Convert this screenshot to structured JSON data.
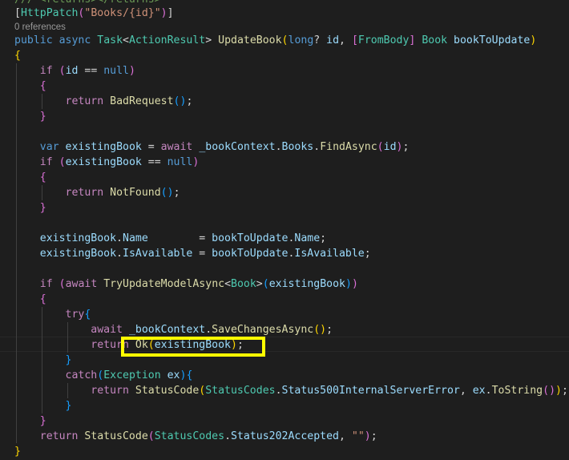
{
  "code": {
    "l0": "/// <returns></returns>",
    "l1": [
      {
        "t": "[",
        "c": "p"
      },
      {
        "t": "HttpPatch",
        "c": "type"
      },
      {
        "t": "(",
        "c": "b2"
      },
      {
        "t": "\"Books/{id}\"",
        "c": "str"
      },
      {
        "t": ")",
        "c": "b2"
      },
      {
        "t": "]",
        "c": "p"
      }
    ],
    "refs": "0 references",
    "l3": [
      {
        "t": "public",
        "c": "kw"
      },
      {
        "t": " ",
        "c": "p"
      },
      {
        "t": "async",
        "c": "kw"
      },
      {
        "t": " ",
        "c": "p"
      },
      {
        "t": "Task",
        "c": "type"
      },
      {
        "t": "<",
        "c": "p"
      },
      {
        "t": "ActionResult",
        "c": "type"
      },
      {
        "t": "> ",
        "c": "p"
      },
      {
        "t": "UpdateBook",
        "c": "fn"
      },
      {
        "t": "(",
        "c": "b1"
      },
      {
        "t": "long",
        "c": "kw"
      },
      {
        "t": "? ",
        "c": "p"
      },
      {
        "t": "id",
        "c": "var"
      },
      {
        "t": ", ",
        "c": "p"
      },
      {
        "t": "[",
        "c": "b2"
      },
      {
        "t": "FromBody",
        "c": "type"
      },
      {
        "t": "]",
        "c": "b2"
      },
      {
        "t": " ",
        "c": "p"
      },
      {
        "t": "Book",
        "c": "type"
      },
      {
        "t": " ",
        "c": "p"
      },
      {
        "t": "bookToUpdate",
        "c": "var"
      },
      {
        "t": ")",
        "c": "b1"
      }
    ],
    "l4": [
      {
        "t": "{",
        "c": "b1"
      }
    ],
    "l5": [
      {
        "t": "    ",
        "c": "p"
      },
      {
        "t": "if",
        "c": "ctl"
      },
      {
        "t": " ",
        "c": "p"
      },
      {
        "t": "(",
        "c": "b2"
      },
      {
        "t": "id",
        "c": "var"
      },
      {
        "t": " == ",
        "c": "p"
      },
      {
        "t": "null",
        "c": "kw"
      },
      {
        "t": ")",
        "c": "b2"
      }
    ],
    "l6": [
      {
        "t": "    ",
        "c": "p"
      },
      {
        "t": "{",
        "c": "b2"
      }
    ],
    "l7": [
      {
        "t": "        ",
        "c": "p"
      },
      {
        "t": "return",
        "c": "ctl"
      },
      {
        "t": " ",
        "c": "p"
      },
      {
        "t": "BadRequest",
        "c": "fn"
      },
      {
        "t": "(",
        "c": "b3"
      },
      {
        "t": ")",
        "c": "b3"
      },
      {
        "t": ";",
        "c": "p"
      }
    ],
    "l8": [
      {
        "t": "    ",
        "c": "p"
      },
      {
        "t": "}",
        "c": "b2"
      }
    ],
    "l10": [
      {
        "t": "    ",
        "c": "p"
      },
      {
        "t": "var",
        "c": "kw"
      },
      {
        "t": " ",
        "c": "p"
      },
      {
        "t": "existingBook",
        "c": "var"
      },
      {
        "t": " = ",
        "c": "p"
      },
      {
        "t": "await",
        "c": "ctl"
      },
      {
        "t": " ",
        "c": "p"
      },
      {
        "t": "_bookContext",
        "c": "var"
      },
      {
        "t": ".",
        "c": "p"
      },
      {
        "t": "Books",
        "c": "var"
      },
      {
        "t": ".",
        "c": "p"
      },
      {
        "t": "FindAsync",
        "c": "fn"
      },
      {
        "t": "(",
        "c": "b2"
      },
      {
        "t": "id",
        "c": "var"
      },
      {
        "t": ")",
        "c": "b2"
      },
      {
        "t": ";",
        "c": "p"
      }
    ],
    "l11": [
      {
        "t": "    ",
        "c": "p"
      },
      {
        "t": "if",
        "c": "ctl"
      },
      {
        "t": " ",
        "c": "p"
      },
      {
        "t": "(",
        "c": "b2"
      },
      {
        "t": "existingBook",
        "c": "var"
      },
      {
        "t": " == ",
        "c": "p"
      },
      {
        "t": "null",
        "c": "kw"
      },
      {
        "t": ")",
        "c": "b2"
      }
    ],
    "l12": [
      {
        "t": "    ",
        "c": "p"
      },
      {
        "t": "{",
        "c": "b2"
      }
    ],
    "l13": [
      {
        "t": "        ",
        "c": "p"
      },
      {
        "t": "return",
        "c": "ctl"
      },
      {
        "t": " ",
        "c": "p"
      },
      {
        "t": "NotFound",
        "c": "fn"
      },
      {
        "t": "(",
        "c": "b3"
      },
      {
        "t": ")",
        "c": "b3"
      },
      {
        "t": ";",
        "c": "p"
      }
    ],
    "l14": [
      {
        "t": "    ",
        "c": "p"
      },
      {
        "t": "}",
        "c": "b2"
      }
    ],
    "l16": [
      {
        "t": "    ",
        "c": "p"
      },
      {
        "t": "existingBook",
        "c": "var"
      },
      {
        "t": ".",
        "c": "p"
      },
      {
        "t": "Name",
        "c": "var"
      },
      {
        "t": "        = ",
        "c": "p"
      },
      {
        "t": "bookToUpdate",
        "c": "var"
      },
      {
        "t": ".",
        "c": "p"
      },
      {
        "t": "Name",
        "c": "var"
      },
      {
        "t": ";",
        "c": "p"
      }
    ],
    "l17": [
      {
        "t": "    ",
        "c": "p"
      },
      {
        "t": "existingBook",
        "c": "var"
      },
      {
        "t": ".",
        "c": "p"
      },
      {
        "t": "IsAvailable",
        "c": "var"
      },
      {
        "t": " = ",
        "c": "p"
      },
      {
        "t": "bookToUpdate",
        "c": "var"
      },
      {
        "t": ".",
        "c": "p"
      },
      {
        "t": "IsAvailable",
        "c": "var"
      },
      {
        "t": ";",
        "c": "p"
      }
    ],
    "l19": [
      {
        "t": "    ",
        "c": "p"
      },
      {
        "t": "if",
        "c": "ctl"
      },
      {
        "t": " ",
        "c": "p"
      },
      {
        "t": "(",
        "c": "b2"
      },
      {
        "t": "await",
        "c": "ctl"
      },
      {
        "t": " ",
        "c": "p"
      },
      {
        "t": "TryUpdateModelAsync",
        "c": "fn"
      },
      {
        "t": "<",
        "c": "p"
      },
      {
        "t": "Book",
        "c": "type"
      },
      {
        "t": ">",
        "c": "p"
      },
      {
        "t": "(",
        "c": "b3"
      },
      {
        "t": "existingBook",
        "c": "var"
      },
      {
        "t": ")",
        "c": "b3"
      },
      {
        "t": ")",
        "c": "b2"
      }
    ],
    "l20": [
      {
        "t": "    ",
        "c": "p"
      },
      {
        "t": "{",
        "c": "b2"
      }
    ],
    "l21": [
      {
        "t": "        ",
        "c": "p"
      },
      {
        "t": "try",
        "c": "ctl"
      },
      {
        "t": "{",
        "c": "b3"
      }
    ],
    "l22": [
      {
        "t": "            ",
        "c": "p"
      },
      {
        "t": "await",
        "c": "ctl"
      },
      {
        "t": " ",
        "c": "p"
      },
      {
        "t": "_bookContext",
        "c": "var"
      },
      {
        "t": ".",
        "c": "p"
      },
      {
        "t": "SaveChangesAsync",
        "c": "fn"
      },
      {
        "t": "(",
        "c": "b1"
      },
      {
        "t": ")",
        "c": "b1"
      },
      {
        "t": ";",
        "c": "p"
      }
    ],
    "l23": [
      {
        "t": "            ",
        "c": "p"
      },
      {
        "t": "return",
        "c": "ctl"
      },
      {
        "t": " ",
        "c": "p"
      },
      {
        "t": "Ok",
        "c": "fn"
      },
      {
        "t": "(",
        "c": "b1"
      },
      {
        "t": "existingBook",
        "c": "var"
      },
      {
        "t": ")",
        "c": "b1"
      },
      {
        "t": ";",
        "c": "p"
      }
    ],
    "l24": [
      {
        "t": "        ",
        "c": "p"
      },
      {
        "t": "}",
        "c": "b3"
      }
    ],
    "l25": [
      {
        "t": "        ",
        "c": "p"
      },
      {
        "t": "catch",
        "c": "ctl"
      },
      {
        "t": "(",
        "c": "b3"
      },
      {
        "t": "Exception",
        "c": "type"
      },
      {
        "t": " ",
        "c": "p"
      },
      {
        "t": "ex",
        "c": "var"
      },
      {
        "t": ")",
        "c": "b3"
      },
      {
        "t": "{",
        "c": "b3"
      }
    ],
    "l26": [
      {
        "t": "            ",
        "c": "p"
      },
      {
        "t": "return",
        "c": "ctl"
      },
      {
        "t": " ",
        "c": "p"
      },
      {
        "t": "StatusCode",
        "c": "fn"
      },
      {
        "t": "(",
        "c": "b1"
      },
      {
        "t": "StatusCodes",
        "c": "type"
      },
      {
        "t": ".",
        "c": "p"
      },
      {
        "t": "Status500InternalServerError",
        "c": "var"
      },
      {
        "t": ", ",
        "c": "p"
      },
      {
        "t": "ex",
        "c": "var"
      },
      {
        "t": ".",
        "c": "p"
      },
      {
        "t": "ToString",
        "c": "fn"
      },
      {
        "t": "(",
        "c": "b2"
      },
      {
        "t": ")",
        "c": "b2"
      },
      {
        "t": ")",
        "c": "b1"
      },
      {
        "t": ";",
        "c": "p"
      }
    ],
    "l27": [
      {
        "t": "        ",
        "c": "p"
      },
      {
        "t": "}",
        "c": "b3"
      }
    ],
    "l28": [
      {
        "t": "    ",
        "c": "p"
      },
      {
        "t": "}",
        "c": "b2"
      }
    ],
    "l29": [
      {
        "t": "    ",
        "c": "p"
      },
      {
        "t": "return",
        "c": "ctl"
      },
      {
        "t": " ",
        "c": "p"
      },
      {
        "t": "StatusCode",
        "c": "fn"
      },
      {
        "t": "(",
        "c": "b2"
      },
      {
        "t": "StatusCodes",
        "c": "type"
      },
      {
        "t": ".",
        "c": "p"
      },
      {
        "t": "Status202Accepted",
        "c": "var"
      },
      {
        "t": ", ",
        "c": "p"
      },
      {
        "t": "\"\"",
        "c": "str"
      },
      {
        "t": ")",
        "c": "b2"
      },
      {
        "t": ";",
        "c": "p"
      }
    ],
    "l30": [
      {
        "t": "}",
        "c": "b1"
      }
    ]
  },
  "colors": {
    "background": "#1e1e1e",
    "keyword": "#569cd6",
    "control": "#c586c0",
    "type": "#4ec9b0",
    "function": "#dcdcaa",
    "variable": "#9cdcfe",
    "string": "#ce9178",
    "highlight_box": "#ffff00"
  }
}
